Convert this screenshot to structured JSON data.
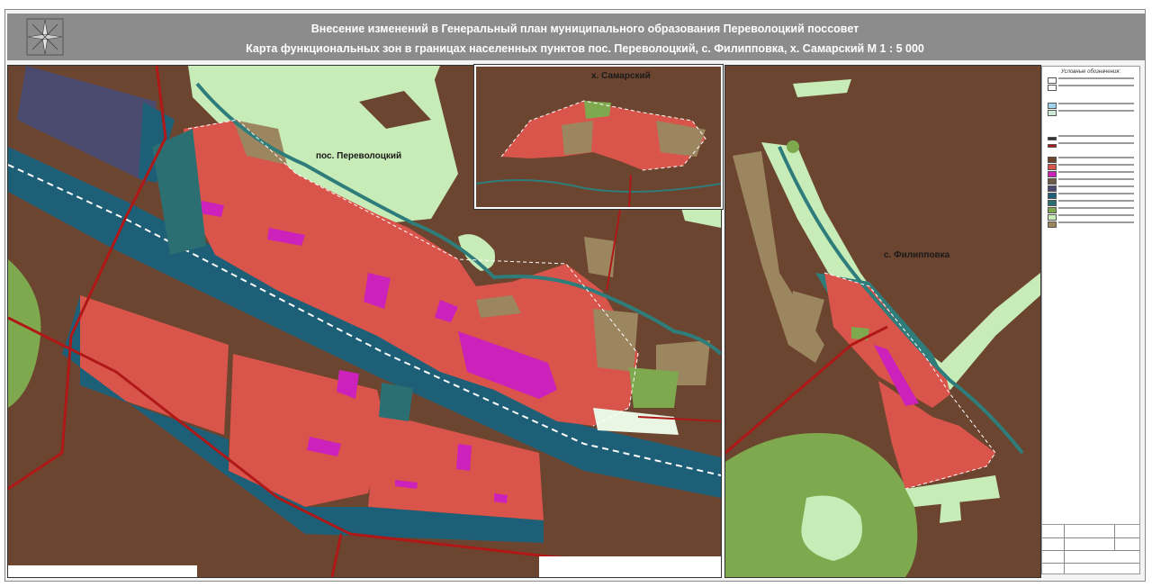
{
  "header": {
    "title_line1": "Внесение изменений в Генеральный план муниципального образования Переволоцкий поссовет",
    "title_line2": "Карта функциональных зон в границах населенных пунктов пос. Переволоцкий, с. Филипповка, х. Самарский М 1 : 5 000"
  },
  "maps": {
    "main_label": "пос.  Переволоцкий",
    "inset_label": "х. Самарский",
    "right_label": "с. Филипповка"
  },
  "legend": {
    "title": "Условные обозначения:"
  },
  "colors": {
    "agricultural": "#6b4530",
    "residential": "#d9544a",
    "public_business": "#cc22bb",
    "recreation": "#c8ecb8",
    "forest": "#7fa94e",
    "transport": "#1e5f78",
    "railway_buffer": "#2c6f72",
    "production": "#4a4a6e",
    "special": "#9c8660",
    "river": "#2e7d7b",
    "road": "#b01818"
  },
  "icons": {
    "compass": "compass-rose-icon"
  }
}
